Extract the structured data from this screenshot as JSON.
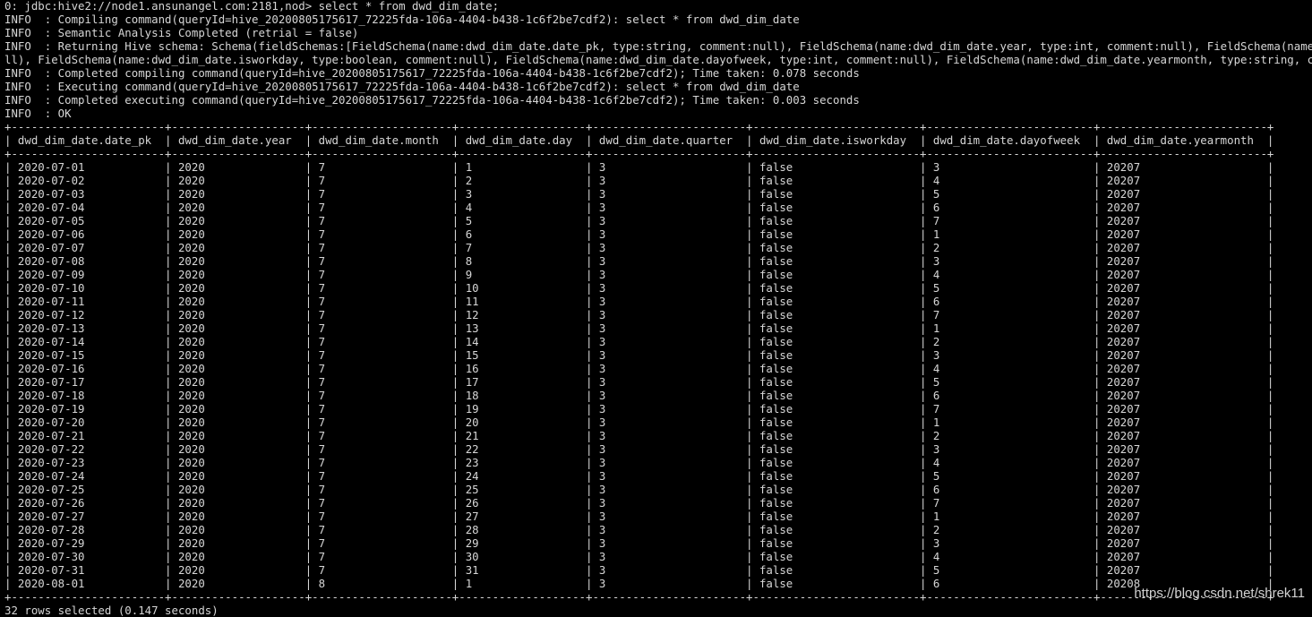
{
  "terminal": {
    "prompt_line": "0: jdbc:hive2://node1.ansunangel.com:2181,nod> select * from dwd_dim_date;",
    "log_lines": [
      "INFO  : Compiling command(queryId=hive_20200805175617_72225fda-106a-4404-b438-1c6f2be7cdf2): select * from dwd_dim_date",
      "INFO  : Semantic Analysis Completed (retrial = false)",
      "INFO  : Returning Hive schema: Schema(fieldSchemas:[FieldSchema(name:dwd_dim_date.date_pk, type:string, comment:null), FieldSchema(name:dwd_dim_date.year, type:int, comment:null), FieldSchema(name:dwd_dim_date",
      "ll), FieldSchema(name:dwd_dim_date.isworkday, type:boolean, comment:null), FieldSchema(name:dwd_dim_date.dayofweek, type:int, comment:null), FieldSchema(name:dwd_dim_date.yearmonth, type:string, comment:null)",
      "INFO  : Completed compiling command(queryId=hive_20200805175617_72225fda-106a-4404-b438-1c6f2be7cdf2); Time taken: 0.078 seconds",
      "INFO  : Executing command(queryId=hive_20200805175617_72225fda-106a-4404-b438-1c6f2be7cdf2): select * from dwd_dim_date",
      "INFO  : Completed executing command(queryId=hive_20200805175617_72225fda-106a-4404-b438-1c6f2be7cdf2); Time taken: 0.003 seconds",
      "INFO  : OK"
    ],
    "separator": "+-----------------------+--------------------+---------------------+-------------------+-----------------------+-------------------------+-------------------------+-------------------------+",
    "columns": [
      "dwd_dim_date.date_pk",
      "dwd_dim_date.year",
      "dwd_dim_date.month",
      "dwd_dim_date.day",
      "dwd_dim_date.quarter",
      "dwd_dim_date.isworkday",
      "dwd_dim_date.dayofweek",
      "dwd_dim_date.yearmonth"
    ],
    "rows": [
      [
        "2020-07-01",
        "2020",
        "7",
        "1",
        "3",
        "false",
        "3",
        "20207"
      ],
      [
        "2020-07-02",
        "2020",
        "7",
        "2",
        "3",
        "false",
        "4",
        "20207"
      ],
      [
        "2020-07-03",
        "2020",
        "7",
        "3",
        "3",
        "false",
        "5",
        "20207"
      ],
      [
        "2020-07-04",
        "2020",
        "7",
        "4",
        "3",
        "false",
        "6",
        "20207"
      ],
      [
        "2020-07-05",
        "2020",
        "7",
        "5",
        "3",
        "false",
        "7",
        "20207"
      ],
      [
        "2020-07-06",
        "2020",
        "7",
        "6",
        "3",
        "false",
        "1",
        "20207"
      ],
      [
        "2020-07-07",
        "2020",
        "7",
        "7",
        "3",
        "false",
        "2",
        "20207"
      ],
      [
        "2020-07-08",
        "2020",
        "7",
        "8",
        "3",
        "false",
        "3",
        "20207"
      ],
      [
        "2020-07-09",
        "2020",
        "7",
        "9",
        "3",
        "false",
        "4",
        "20207"
      ],
      [
        "2020-07-10",
        "2020",
        "7",
        "10",
        "3",
        "false",
        "5",
        "20207"
      ],
      [
        "2020-07-11",
        "2020",
        "7",
        "11",
        "3",
        "false",
        "6",
        "20207"
      ],
      [
        "2020-07-12",
        "2020",
        "7",
        "12",
        "3",
        "false",
        "7",
        "20207"
      ],
      [
        "2020-07-13",
        "2020",
        "7",
        "13",
        "3",
        "false",
        "1",
        "20207"
      ],
      [
        "2020-07-14",
        "2020",
        "7",
        "14",
        "3",
        "false",
        "2",
        "20207"
      ],
      [
        "2020-07-15",
        "2020",
        "7",
        "15",
        "3",
        "false",
        "3",
        "20207"
      ],
      [
        "2020-07-16",
        "2020",
        "7",
        "16",
        "3",
        "false",
        "4",
        "20207"
      ],
      [
        "2020-07-17",
        "2020",
        "7",
        "17",
        "3",
        "false",
        "5",
        "20207"
      ],
      [
        "2020-07-18",
        "2020",
        "7",
        "18",
        "3",
        "false",
        "6",
        "20207"
      ],
      [
        "2020-07-19",
        "2020",
        "7",
        "19",
        "3",
        "false",
        "7",
        "20207"
      ],
      [
        "2020-07-20",
        "2020",
        "7",
        "20",
        "3",
        "false",
        "1",
        "20207"
      ],
      [
        "2020-07-21",
        "2020",
        "7",
        "21",
        "3",
        "false",
        "2",
        "20207"
      ],
      [
        "2020-07-22",
        "2020",
        "7",
        "22",
        "3",
        "false",
        "3",
        "20207"
      ],
      [
        "2020-07-23",
        "2020",
        "7",
        "23",
        "3",
        "false",
        "4",
        "20207"
      ],
      [
        "2020-07-24",
        "2020",
        "7",
        "24",
        "3",
        "false",
        "5",
        "20207"
      ],
      [
        "2020-07-25",
        "2020",
        "7",
        "25",
        "3",
        "false",
        "6",
        "20207"
      ],
      [
        "2020-07-26",
        "2020",
        "7",
        "26",
        "3",
        "false",
        "7",
        "20207"
      ],
      [
        "2020-07-27",
        "2020",
        "7",
        "27",
        "3",
        "false",
        "1",
        "20207"
      ],
      [
        "2020-07-28",
        "2020",
        "7",
        "28",
        "3",
        "false",
        "2",
        "20207"
      ],
      [
        "2020-07-29",
        "2020",
        "7",
        "29",
        "3",
        "false",
        "3",
        "20207"
      ],
      [
        "2020-07-30",
        "2020",
        "7",
        "30",
        "3",
        "false",
        "4",
        "20207"
      ],
      [
        "2020-07-31",
        "2020",
        "7",
        "31",
        "3",
        "false",
        "5",
        "20207"
      ],
      [
        "2020-08-01",
        "2020",
        "8",
        "1",
        "3",
        "false",
        "6",
        "20208"
      ]
    ],
    "footer": "32 rows selected (0.147 seconds)"
  },
  "watermark": "https://blog.csdn.net/shrek11",
  "colors": {
    "background": "#000000",
    "text": "#d6d6d6"
  }
}
